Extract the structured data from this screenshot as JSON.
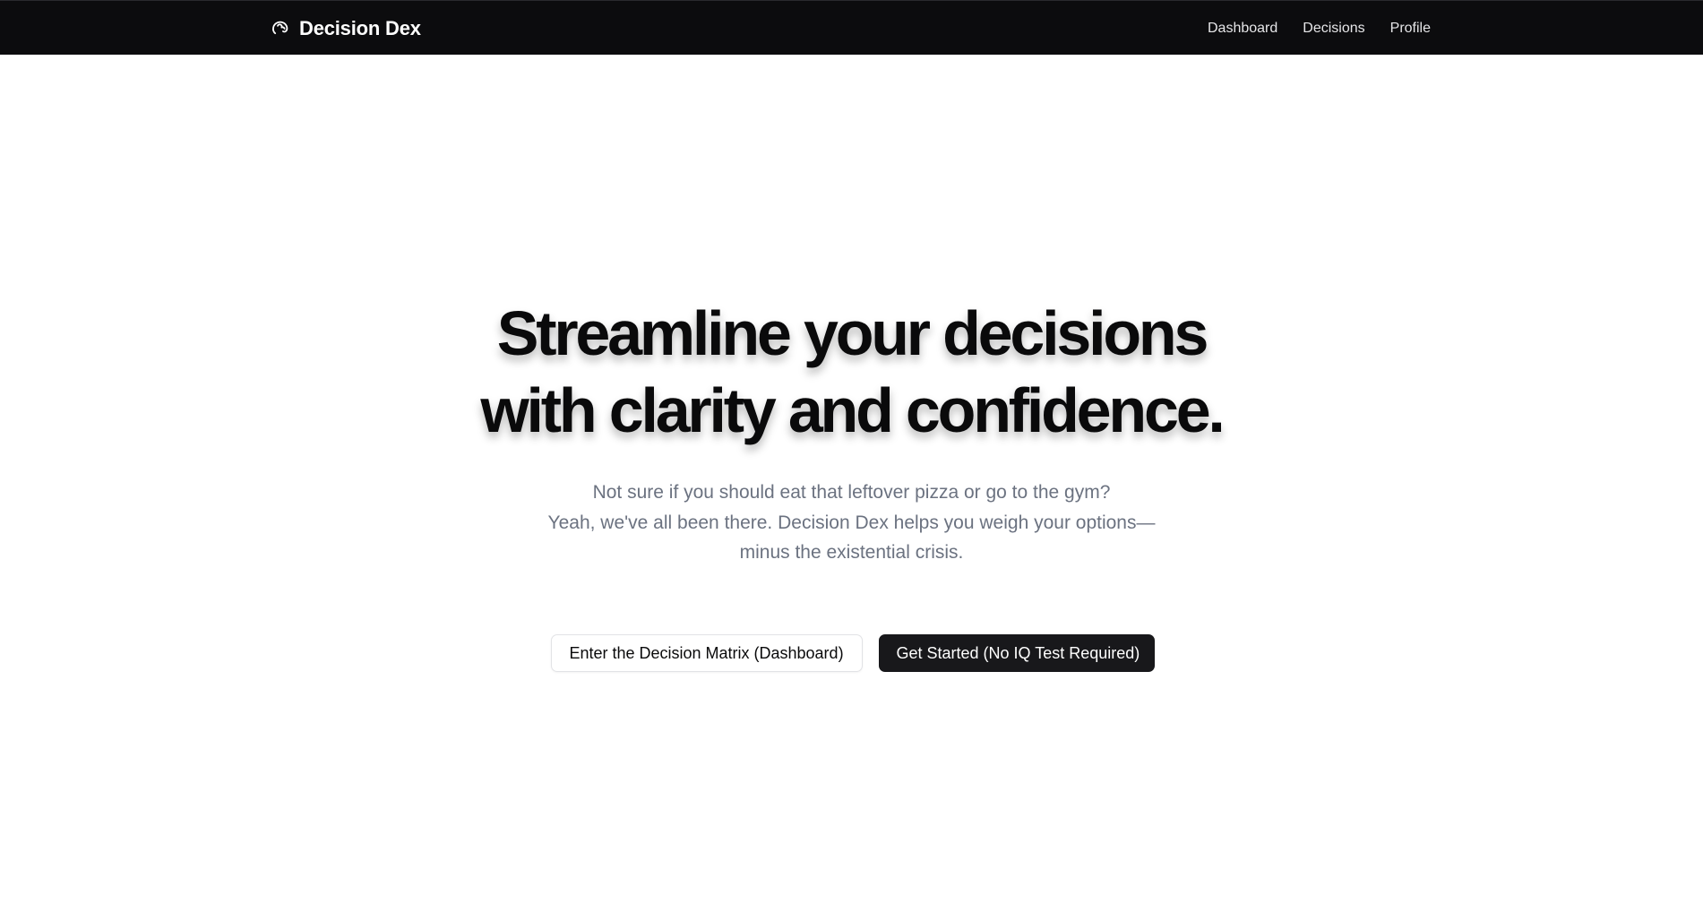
{
  "navbar": {
    "brand_name": "Decision Dex",
    "brand_icon": "brain-icon",
    "links": [
      {
        "label": "Dashboard"
      },
      {
        "label": "Decisions"
      },
      {
        "label": "Profile"
      }
    ]
  },
  "hero": {
    "headline_line1": "Streamline your decisions",
    "headline_line2": "with clarity and confidence.",
    "subtitle_line1": "Not sure if you should eat that leftover pizza or go to the gym?",
    "subtitle_line2": "Yeah, we've all been there. Decision Dex helps you weigh your options—",
    "subtitle_line3": "minus the existential crisis.",
    "secondary_cta": "Enter the Decision Matrix (Dashboard)",
    "primary_cta": "Get Started (No IQ Test Required)"
  },
  "colors": {
    "navbar_bg": "#0c0c0e",
    "headline": "#0a0a0b",
    "subtitle": "#6b7280",
    "primary_button_bg": "#18181b",
    "secondary_button_border": "#e2e3e6"
  }
}
